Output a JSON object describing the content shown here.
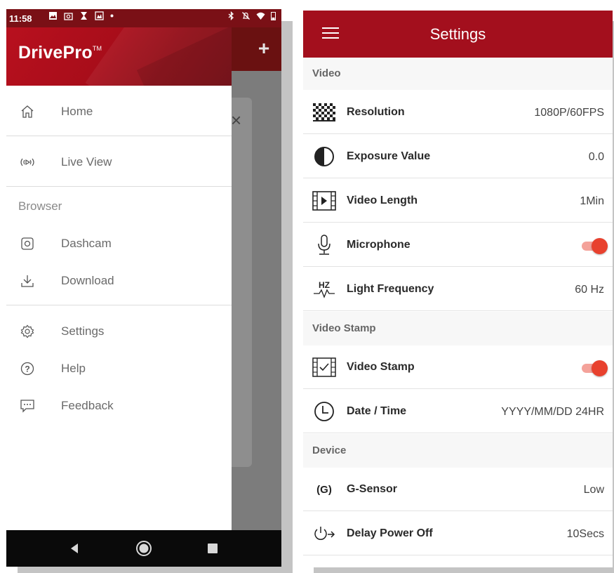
{
  "left": {
    "statusbar": {
      "time": "11:58"
    },
    "drawer": {
      "brand": "DrivePro",
      "brand_tm": "TM",
      "items_top": [
        {
          "label": "Home",
          "icon": "home-icon"
        },
        {
          "label": "Live View",
          "icon": "live-view-icon"
        }
      ],
      "browser_section": "Browser",
      "items_browser": [
        {
          "label": "Dashcam",
          "icon": "dashcam-icon"
        },
        {
          "label": "Download",
          "icon": "download-icon"
        }
      ],
      "items_bottom": [
        {
          "label": "Settings",
          "icon": "gear-icon"
        },
        {
          "label": "Help",
          "icon": "help-icon"
        },
        {
          "label": "Feedback",
          "icon": "feedback-icon"
        }
      ]
    },
    "background_app": {
      "add_symbol": "+",
      "close_symbol": "×"
    }
  },
  "right": {
    "title": "Settings",
    "sections": {
      "video": "Video",
      "video_stamp": "Video Stamp",
      "device": "Device"
    },
    "rows": {
      "resolution": {
        "label": "Resolution",
        "value": "1080P/60FPS",
        "icon": "resolution-icon"
      },
      "exposure": {
        "label": "Exposure Value",
        "value": "0.0",
        "icon": "exposure-icon"
      },
      "video_length": {
        "label": "Video Length",
        "value": "1Min",
        "icon": "video-length-icon"
      },
      "microphone": {
        "label": "Microphone",
        "enabled": true,
        "icon": "microphone-icon"
      },
      "light_frequency": {
        "label": "Light Frequency",
        "value": "60 Hz",
        "icon": "light-frequency-icon",
        "icon_text": "HZ"
      },
      "video_stamp": {
        "label": "Video Stamp",
        "enabled": true,
        "icon": "video-stamp-icon"
      },
      "date_time": {
        "label": "Date / Time",
        "value": "YYYY/MM/DD 24HR",
        "icon": "clock-icon"
      },
      "g_sensor": {
        "label": "G-Sensor",
        "value": "Low",
        "icon": "g-sensor-icon",
        "icon_text": "(G)"
      },
      "delay_power_off": {
        "label": "Delay Power Off",
        "value": "10Secs",
        "icon": "power-delay-icon"
      }
    }
  },
  "colors": {
    "brand_red": "#a30f1d",
    "toggle_on": "#e8412e",
    "toggle_track": "#f4a29a"
  }
}
